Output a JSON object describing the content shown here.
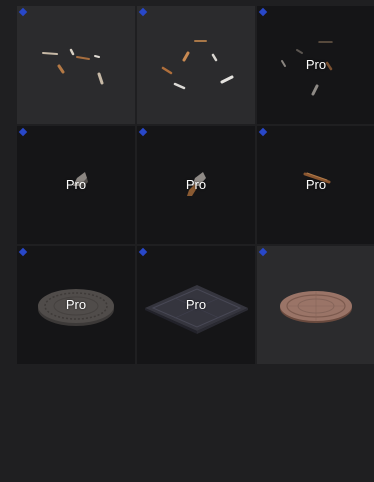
{
  "assets": [
    {
      "thumbnail": "scattered-wood-bits",
      "pro_label": ""
    },
    {
      "thumbnail": "scattered-wood-and-bone-bits",
      "pro_label": ""
    },
    {
      "thumbnail": "scattered-sticks-dark",
      "pro_label": "Pro"
    },
    {
      "thumbnail": "single-stone-chunk",
      "pro_label": "Pro"
    },
    {
      "thumbnail": "single-stone-chunk-brown",
      "pro_label": "Pro"
    },
    {
      "thumbnail": "single-wooden-stick",
      "pro_label": "Pro"
    },
    {
      "thumbnail": "round-stone-floor-plate",
      "pro_label": "Pro"
    },
    {
      "thumbnail": "square-metal-grate-plate",
      "pro_label": "Pro"
    },
    {
      "thumbnail": "round-rusted-plate",
      "pro_label": ""
    }
  ],
  "colors": {
    "badge": "#2847c9",
    "tile_light": "#2b2b2d",
    "tile_dark": "#151517",
    "background": "#1f1f21"
  }
}
